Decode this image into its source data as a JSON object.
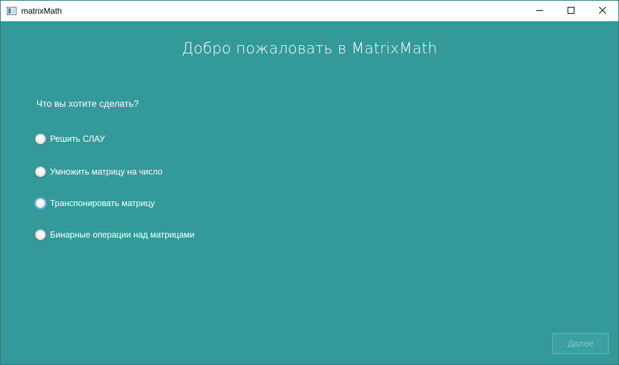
{
  "window": {
    "title": "matrixMath",
    "controls": {
      "minimize": "minimize-icon",
      "maximize": "maximize-icon",
      "close": "close-icon"
    }
  },
  "main": {
    "welcome": "Добро пожаловать в MatrixMath",
    "question": "Что вы хотите сделать?",
    "options": [
      {
        "label": "Решить СЛАУ",
        "selected": false,
        "focused": false
      },
      {
        "label": "Умножить матрицу на число",
        "selected": false,
        "focused": false
      },
      {
        "label": "Транспонировать матрицу",
        "selected": false,
        "focused": true
      },
      {
        "label": "Бинарные операции над матрицами",
        "selected": false,
        "focused": false
      }
    ],
    "next_label": "Далее",
    "next_enabled": false
  },
  "colors": {
    "background": "#339999",
    "text": "#ffffff",
    "disabled_text": "#8cc8c8"
  }
}
